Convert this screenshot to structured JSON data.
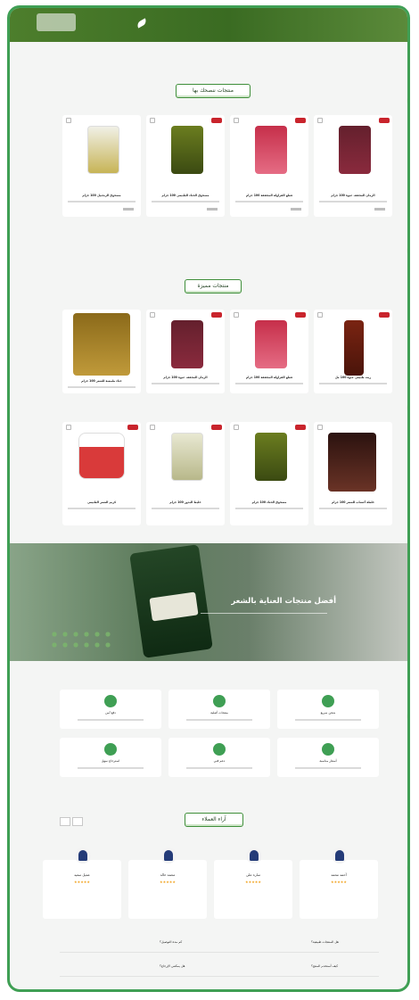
{
  "sections": {
    "recommended_title": "منتجات ننصحك بها",
    "bestsellers_title": "منتجات مميزة",
    "reviews_title": "آراء العملاء"
  },
  "recommended_products": [
    {
      "name": "الرمان المجفف عبوة 100 جرام",
      "bag": "maroon"
    },
    {
      "name": "قطع الفراولة المجففة 100 جرام",
      "bag": "red"
    },
    {
      "name": "مسحوق الحناء الطبيعي 100 جرام",
      "bag": "olive"
    },
    {
      "name": "مسحوق الزنجبيل 100 جرام",
      "bag": "white"
    }
  ],
  "featured_products": [
    {
      "name": "زيت طبيعي عبوة 100 مل",
      "bag": "rust"
    },
    {
      "name": "قطع الفراولة المجففة 100 جرام",
      "bag": "red"
    },
    {
      "name": "الرمان المجفف عبوة 100 جرام",
      "bag": "maroon"
    },
    {
      "name": "حناء طبيعية للشعر 100 جرام",
      "bag": "gold"
    },
    {
      "name": "خلطة أعشاب للشعر 100 جرام",
      "bag": "darkbag"
    },
    {
      "name": "مسحوق الحناء 100 جرام",
      "bag": "olive"
    },
    {
      "name": "خليط البذور 100 جرام",
      "bag": "mix"
    },
    {
      "name": "كريم الشعر الطبيعي",
      "bag": "tub"
    }
  ],
  "banner": {
    "title": "أفضل منتجات العناية بالشعر"
  },
  "features": [
    {
      "label": "شحن سريع"
    },
    {
      "label": "منتجات أصلية"
    },
    {
      "label": "دفع آمن"
    },
    {
      "label": "أسعار مناسبة"
    },
    {
      "label": "دعم فني"
    },
    {
      "label": "استرجاع سهل"
    }
  ],
  "reviews": [
    {
      "name": "أحمد محمد",
      "stars": "★★★★★"
    },
    {
      "name": "سارة علي",
      "stars": "★★★★★"
    },
    {
      "name": "محمد خالد",
      "stars": "★★★★★"
    },
    {
      "name": "عميل سعيد",
      "stars": "★★★★★"
    }
  ],
  "faq": [
    {
      "q": "هل المنتجات طبيعية؟"
    },
    {
      "q": "كم مدة التوصيل؟"
    },
    {
      "q": "كيف أستخدم المنتج؟"
    },
    {
      "q": "هل يمكنني الإرجاع؟"
    }
  ],
  "colors": {
    "accent": "#3f9f54",
    "badge": "#c9242c",
    "header": "#3a6b22"
  }
}
